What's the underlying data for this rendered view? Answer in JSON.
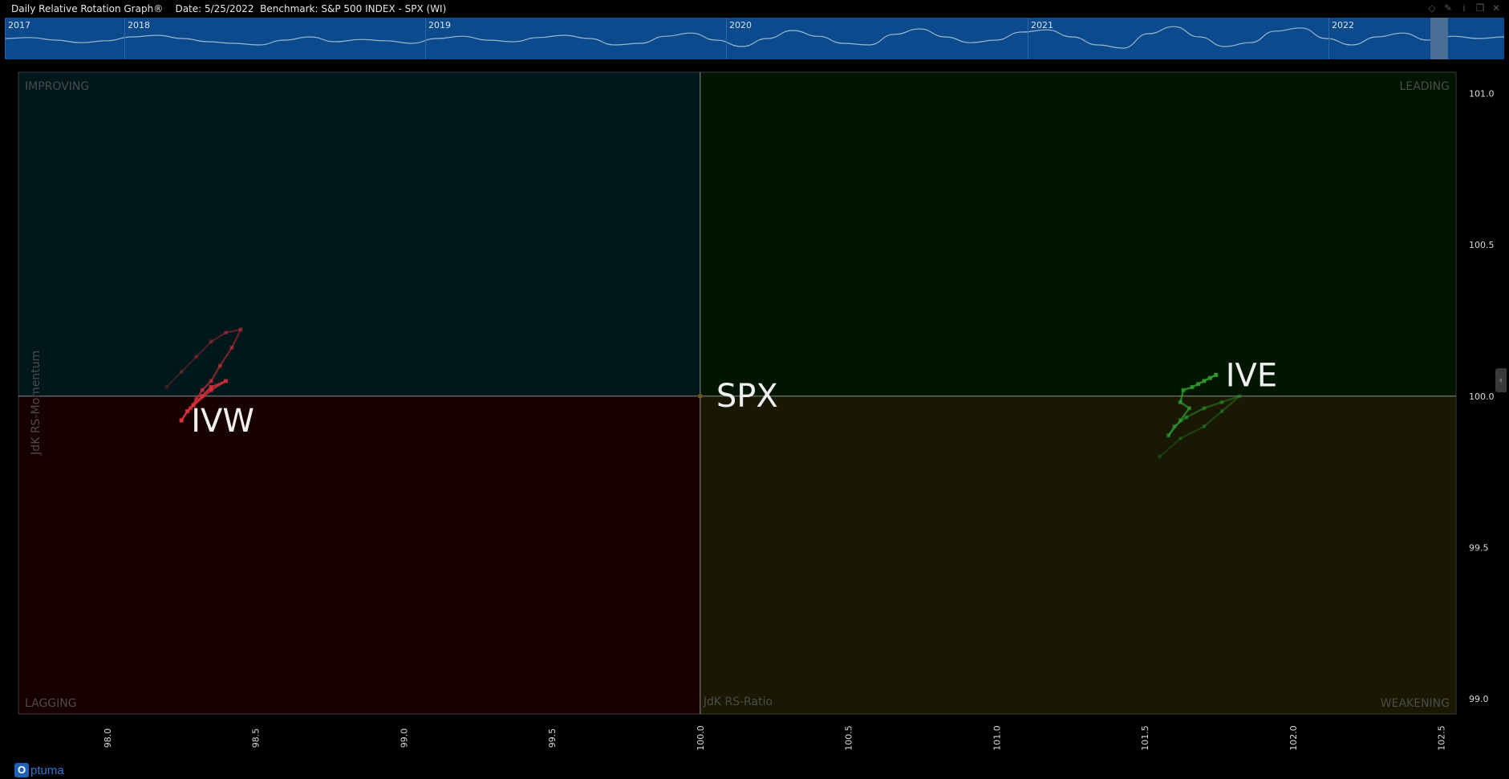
{
  "window": {
    "title": "Daily Relative Rotation Graph®    Date: 5/25/2022  Benchmark: S&P 500 INDEX - SPX (WI)",
    "icons": [
      "diamond-icon",
      "pin-icon",
      "info-icon",
      "restore-icon",
      "close-icon"
    ]
  },
  "timeline": {
    "years": [
      "2017",
      "2018",
      "2019",
      "2020",
      "2021",
      "2022"
    ],
    "wave": [
      0.55,
      0.58,
      0.5,
      0.42,
      0.48,
      0.6,
      0.65,
      0.55,
      0.45,
      0.4,
      0.35,
      0.5,
      0.6,
      0.45,
      0.52,
      0.48,
      0.4,
      0.55,
      0.62,
      0.5,
      0.45,
      0.58,
      0.65,
      0.55,
      0.35,
      0.4,
      0.62,
      0.72,
      0.5,
      0.3,
      0.55,
      0.8,
      0.62,
      0.4,
      0.35,
      0.68,
      0.85,
      0.6,
      0.42,
      0.5,
      0.75,
      0.82,
      0.6,
      0.35,
      0.25,
      0.7,
      0.92,
      0.6,
      0.3,
      0.42,
      0.78,
      0.88,
      0.55,
      0.35,
      0.6,
      0.72,
      0.5,
      0.62,
      0.55,
      0.6
    ]
  },
  "quadrants": {
    "improving": "IMPROVING",
    "leading": "LEADING",
    "lagging": "LAGGING",
    "weakening": "WEAKENING"
  },
  "colors": {
    "improving": "#00181b",
    "leading": "#001600",
    "lagging": "#180000",
    "weakening": "#191903",
    "grid": "#8b8b8b",
    "ivw": "#d9303b",
    "ive": "#2e9a2e"
  },
  "chart_data": {
    "type": "scatter",
    "xlabel": "JdK RS-Ratio",
    "ylabel": "JdK RS-Momentum",
    "xlim": [
      97.7,
      102.55
    ],
    "ylim": [
      98.95,
      101.07
    ],
    "xticks": [
      "98.0",
      "98.5",
      "99.0",
      "99.5",
      "100.0",
      "100.5",
      "101.0",
      "101.5",
      "102.0",
      "102.5"
    ],
    "yticks": [
      "99.0",
      "99.5",
      "100.0",
      "100.5",
      "101.0"
    ],
    "benchmark": {
      "name": "SPX",
      "x": 100.0,
      "y": 100.0
    },
    "series": [
      {
        "name": "IVW",
        "points": [
          [
            98.2,
            100.03
          ],
          [
            98.25,
            100.08
          ],
          [
            98.3,
            100.13
          ],
          [
            98.35,
            100.18
          ],
          [
            98.4,
            100.21
          ],
          [
            98.45,
            100.22
          ],
          [
            98.42,
            100.16
          ],
          [
            98.38,
            100.1
          ],
          [
            98.35,
            100.05
          ],
          [
            98.32,
            100.02
          ],
          [
            98.3,
            99.99
          ],
          [
            98.28,
            99.96
          ],
          [
            98.35,
            100.02
          ],
          [
            98.4,
            100.05
          ],
          [
            98.35,
            100.03
          ],
          [
            98.32,
            100.0
          ],
          [
            98.29,
            99.97
          ],
          [
            98.27,
            99.95
          ],
          [
            98.25,
            99.92
          ]
        ]
      },
      {
        "name": "IVE",
        "points": [
          [
            101.55,
            99.8
          ],
          [
            101.62,
            99.86
          ],
          [
            101.7,
            99.9
          ],
          [
            101.76,
            99.95
          ],
          [
            101.82,
            100.0
          ],
          [
            101.76,
            99.98
          ],
          [
            101.7,
            99.96
          ],
          [
            101.64,
            99.93
          ],
          [
            101.6,
            99.9
          ],
          [
            101.58,
            99.87
          ],
          [
            101.62,
            99.92
          ],
          [
            101.65,
            99.96
          ],
          [
            101.62,
            99.98
          ],
          [
            101.63,
            100.02
          ],
          [
            101.66,
            100.03
          ],
          [
            101.68,
            100.04
          ],
          [
            101.7,
            100.05
          ],
          [
            101.72,
            100.06
          ],
          [
            101.74,
            100.07
          ]
        ]
      }
    ]
  }
}
